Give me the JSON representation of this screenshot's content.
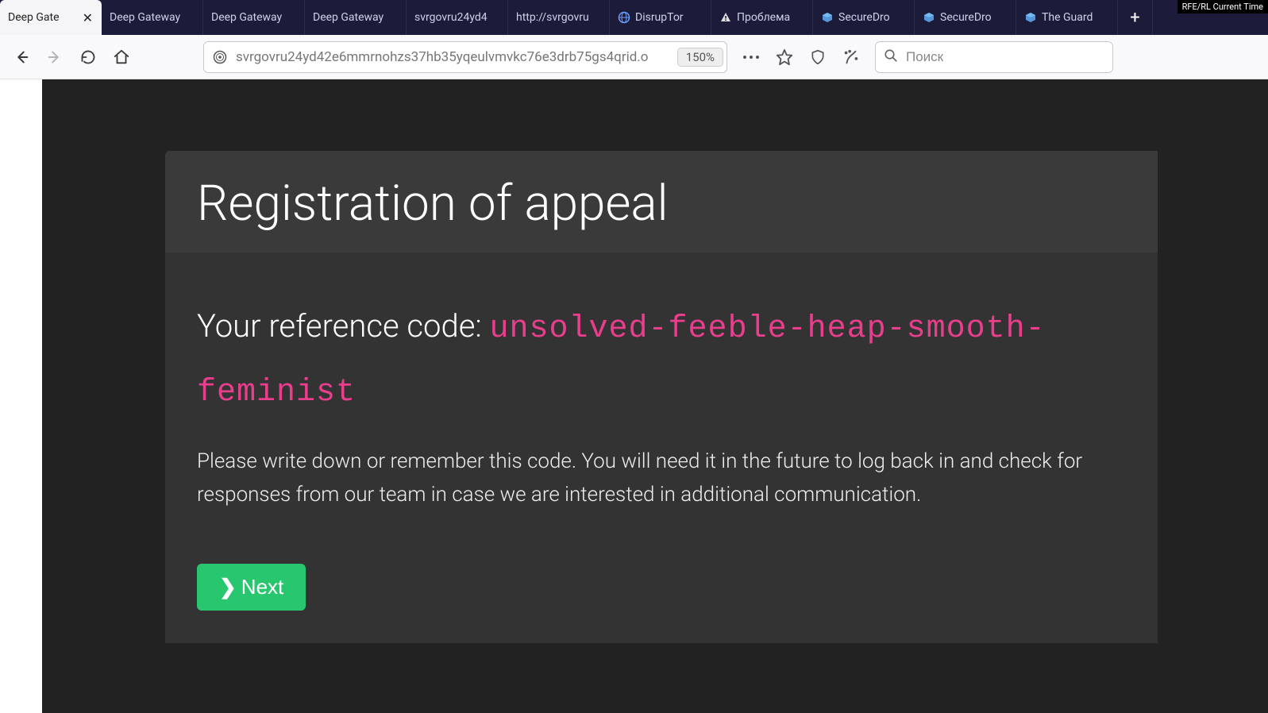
{
  "watermark": "RFE/RL Current Time",
  "tabs": [
    {
      "label": "Deep Gate",
      "active": true,
      "icon": null
    },
    {
      "label": "Deep Gateway",
      "active": false,
      "icon": null
    },
    {
      "label": "Deep Gateway",
      "active": false,
      "icon": null
    },
    {
      "label": "Deep Gateway",
      "active": false,
      "icon": null
    },
    {
      "label": "svrgovru24yd4",
      "active": false,
      "icon": null
    },
    {
      "label": "http://svrgovru",
      "active": false,
      "icon": null
    },
    {
      "label": "DisrupTor",
      "active": false,
      "icon": "globe"
    },
    {
      "label": "Проблема",
      "active": false,
      "icon": "warning"
    },
    {
      "label": "SecureDro",
      "active": false,
      "icon": "cube"
    },
    {
      "label": "SecureDro",
      "active": false,
      "icon": "cube"
    },
    {
      "label": "The Guard",
      "active": false,
      "icon": "cube"
    }
  ],
  "toolbar": {
    "url": "svrgovru24yd42e6mmrnohzs37hb35yqeulvmvkc76e3drb75gs4qrid.o",
    "zoom": "150%",
    "search_placeholder": "Поиск"
  },
  "page": {
    "title": "Registration of appeal",
    "ref_label": "Your reference code: ",
    "ref_code": "unsolved-feeble-heap-smooth-feminist",
    "instructions": "Please write down or remember this code. You will need it in the future to log back in and check for responses from our team in case we are interested in additional communication.",
    "next_label": "Next"
  }
}
